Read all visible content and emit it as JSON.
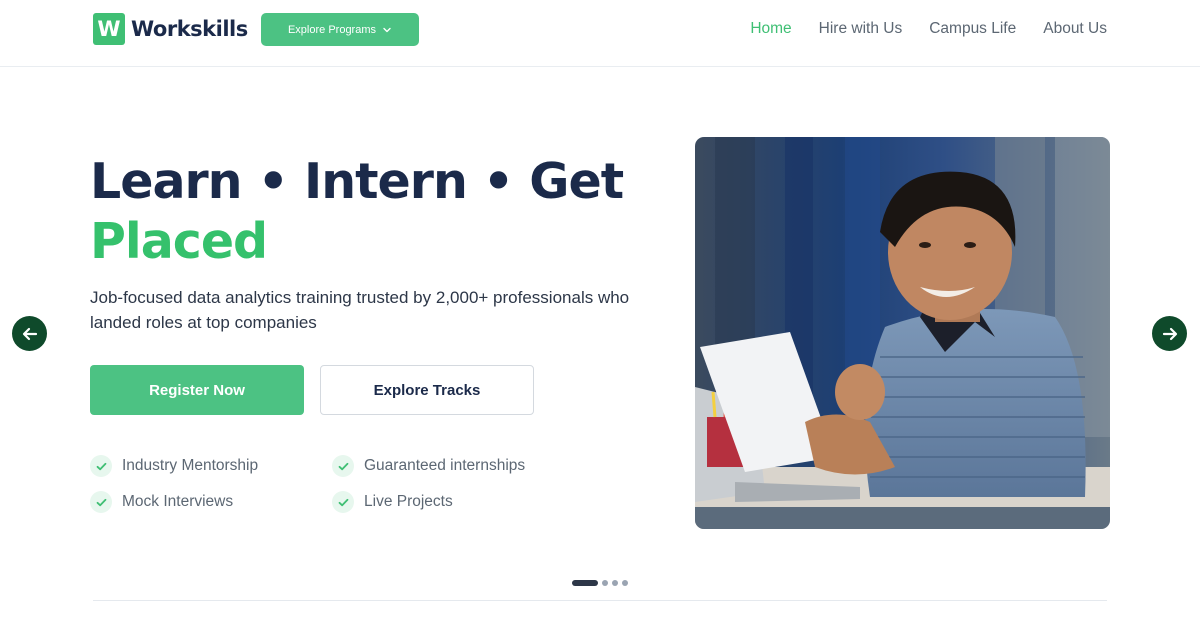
{
  "brand": {
    "logo_letter": "W",
    "name": "Workskills",
    "accent": "#3fbf74"
  },
  "header": {
    "explore_label": "Explore Programs",
    "nav": [
      {
        "label": "Home",
        "active": true
      },
      {
        "label": "Hire with Us",
        "active": false
      },
      {
        "label": "Campus Life",
        "active": false
      },
      {
        "label": "About Us",
        "active": false
      }
    ]
  },
  "hero": {
    "title_line1": "Learn • Intern • Get",
    "title_line2": "Placed",
    "subtitle": "Job-focused data analytics training trusted by 2,000+ professionals who landed roles at top companies",
    "primary_cta": "Register Now",
    "secondary_cta": "Explore Tracks",
    "features": [
      "Industry Mentorship",
      "Guaranteed internships",
      "Mock Interviews",
      "Live Projects"
    ]
  },
  "carousel": {
    "prev_icon": "arrow-left-icon",
    "next_icon": "arrow-right-icon",
    "slide_count": 4,
    "active_slide": 1
  },
  "colors": {
    "primary_green": "#4cc283",
    "title_navy": "#1b2a4a",
    "arrow_dark_green": "#0f4a2b"
  }
}
